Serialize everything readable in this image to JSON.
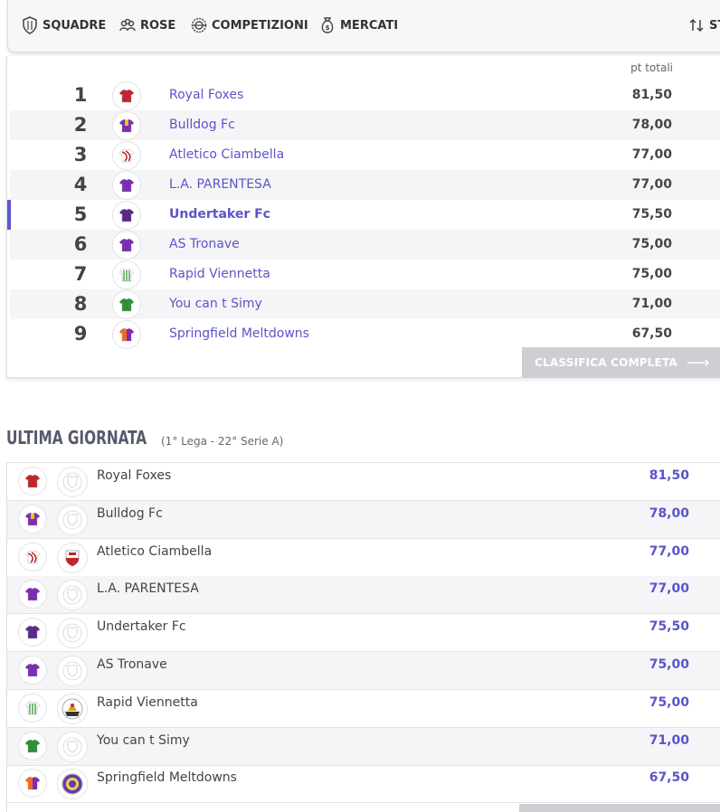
{
  "nav": {
    "items": [
      {
        "label": "SQUADRE",
        "icon": "shield-icon"
      },
      {
        "label": "ROSE",
        "icon": "people-icon"
      },
      {
        "label": "COMPETIZIONI",
        "icon": "badge-icon"
      },
      {
        "label": "MERCATI",
        "icon": "money-bag-icon"
      },
      {
        "label": "STA",
        "icon": "sort-icon"
      }
    ]
  },
  "standings": {
    "column_header": "pt totali",
    "button_label": "CLASSIFICA COMPLETA",
    "rows": [
      {
        "pos": "1",
        "name": "Royal Foxes",
        "pts": "81,50",
        "jersey": "red"
      },
      {
        "pos": "2",
        "name": "Bulldog Fc",
        "pts": "78,00",
        "jersey": "purple-yellow"
      },
      {
        "pos": "3",
        "name": "Atletico Ciambella",
        "pts": "77,00",
        "jersey": "red-white"
      },
      {
        "pos": "4",
        "name": "L.A. PARENTESA",
        "pts": "77,00",
        "jersey": "purple"
      },
      {
        "pos": "5",
        "name": "Undertaker Fc",
        "pts": "75,50",
        "jersey": "dark-purple",
        "current": true
      },
      {
        "pos": "6",
        "name": "AS Tronave",
        "pts": "75,00",
        "jersey": "purple"
      },
      {
        "pos": "7",
        "name": "Rapid Viennetta",
        "pts": "75,00",
        "jersey": "green-stripes"
      },
      {
        "pos": "8",
        "name": "You can t Simy",
        "pts": "71,00",
        "jersey": "green"
      },
      {
        "pos": "9",
        "name": "Springfield Meltdowns",
        "pts": "67,50",
        "jersey": "orange-purple"
      }
    ]
  },
  "last_round": {
    "title": "ULTIMA GIORNATA",
    "subtitle": "(1° Lega - 22° Serie A)",
    "rows": [
      {
        "name": "Royal Foxes",
        "pts": "81,50",
        "jersey": "red",
        "crest": "placeholder"
      },
      {
        "name": "Bulldog Fc",
        "pts": "78,00",
        "jersey": "purple-yellow",
        "crest": "placeholder"
      },
      {
        "name": "Atletico Ciambella",
        "pts": "77,00",
        "jersey": "red-white",
        "crest": "red-shield"
      },
      {
        "name": "L.A. PARENTESA",
        "pts": "77,00",
        "jersey": "purple",
        "crest": "placeholder"
      },
      {
        "name": "Undertaker Fc",
        "pts": "75,50",
        "jersey": "dark-purple",
        "crest": "placeholder"
      },
      {
        "name": "AS Tronave",
        "pts": "75,00",
        "jersey": "purple",
        "crest": "placeholder"
      },
      {
        "name": "Rapid Viennetta",
        "pts": "75,00",
        "jersey": "green-stripes",
        "crest": "dark-crest"
      },
      {
        "name": "You can t Simy",
        "pts": "71,00",
        "jersey": "green",
        "crest": "placeholder"
      },
      {
        "name": "Springfield Meltdowns",
        "pts": "67,50",
        "jersey": "orange-purple",
        "crest": "purple-crest"
      }
    ]
  },
  "colors": {
    "accent": "#5b57d6",
    "link": "#5a55c9",
    "button_bg": "#cfcfd3"
  }
}
